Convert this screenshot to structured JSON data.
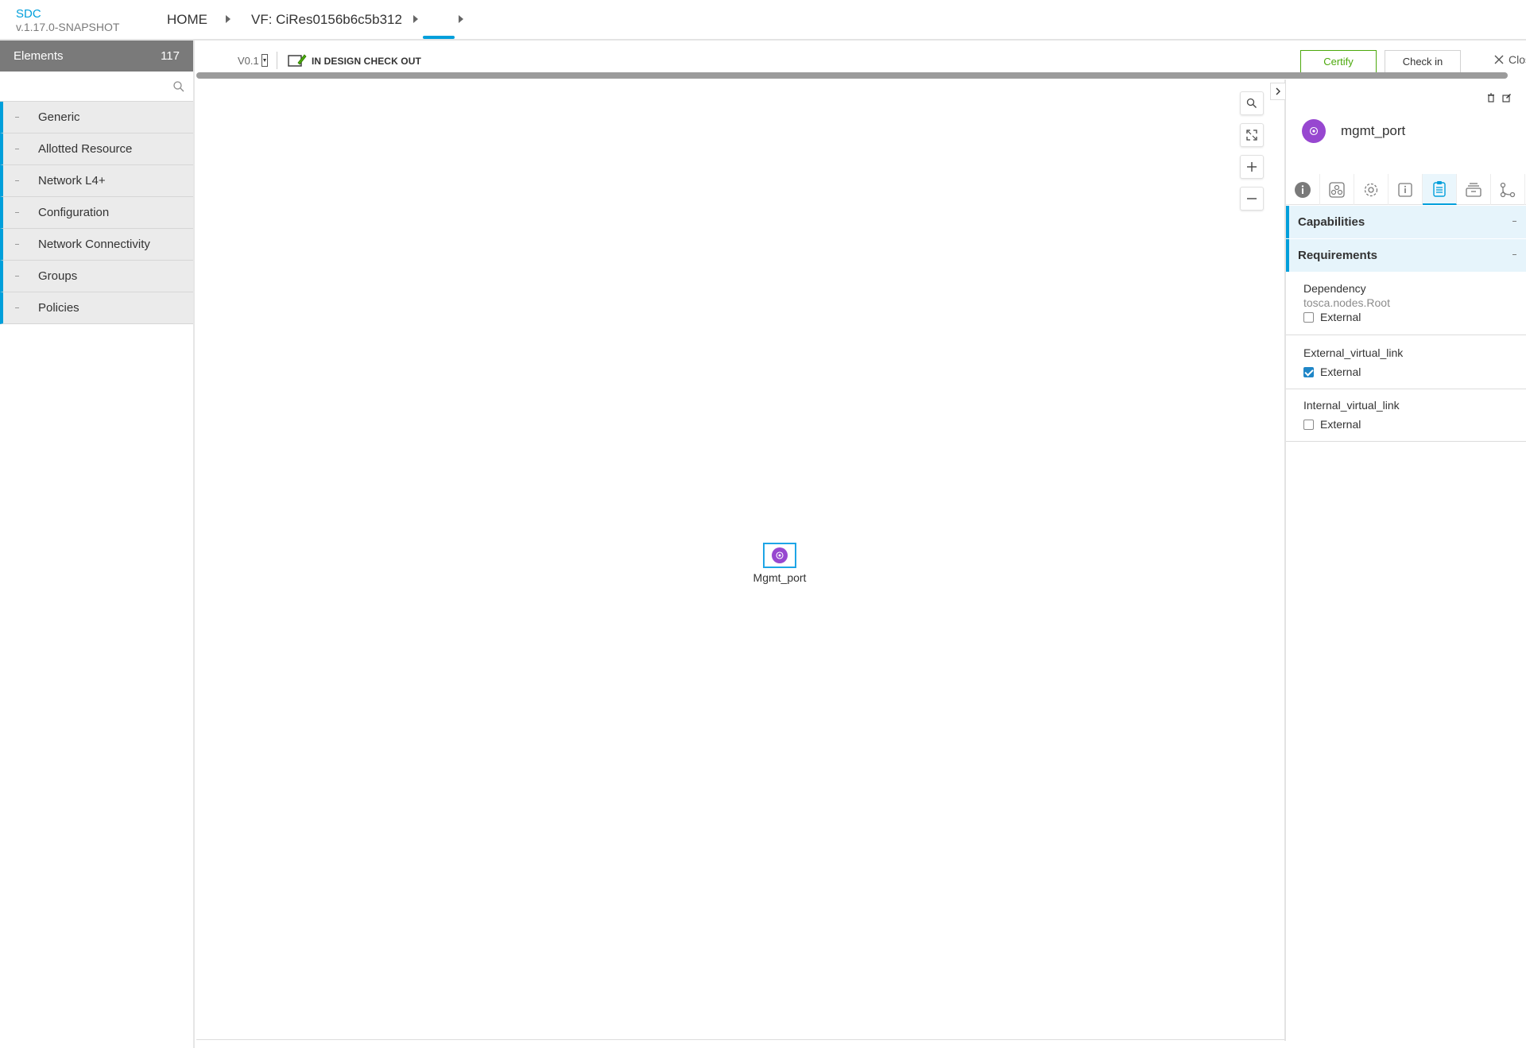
{
  "app": {
    "name": "SDC",
    "version": "v.1.17.0-SNAPSHOT"
  },
  "breadcrumb": {
    "home": "HOME",
    "resource": "VF: CiRes0156b6c5b312"
  },
  "sidebar": {
    "title": "Elements",
    "count": "117",
    "search_placeholder": "",
    "categories": [
      {
        "label": "Generic"
      },
      {
        "label": "Allotted Resource"
      },
      {
        "label": "Network L4+"
      },
      {
        "label": "Configuration"
      },
      {
        "label": "Network Connectivity"
      },
      {
        "label": "Groups"
      },
      {
        "label": "Policies"
      }
    ]
  },
  "toolbar": {
    "version": "V0.1",
    "status": "IN DESIGN CHECK OUT",
    "certify_label": "Certify",
    "checkin_label": "Check in",
    "close_label": "Close"
  },
  "canvas": {
    "node_label": "Mgmt_port"
  },
  "panel": {
    "title": "mgmt_port",
    "sections": {
      "capabilities": "Capabilities",
      "requirements": "Requirements"
    },
    "requirements": [
      {
        "name": "Dependency",
        "type": "tosca.nodes.Root",
        "external_label": "External",
        "external": false
      },
      {
        "name": "External_virtual_link",
        "type": "",
        "external_label": "External",
        "external": true
      },
      {
        "name": "Internal_virtual_link",
        "type": "",
        "external_label": "External",
        "external": false
      }
    ]
  },
  "colors": {
    "accent": "#009fdb",
    "certify": "#4ca90c",
    "node": "#9747d0",
    "sidebar_header": "#7a7a7a"
  }
}
